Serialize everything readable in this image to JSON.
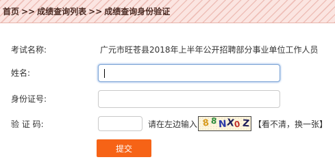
{
  "breadcrumb": {
    "items": [
      "首页",
      "成绩查询列表",
      "成绩查询身份验证"
    ],
    "separator": ">>"
  },
  "exam": {
    "label": "考试名称:",
    "value": "广元市旺苍县2018年上半年公开招聘部分事业单位工作人员"
  },
  "form": {
    "name_label": "姓名:",
    "name_value": "",
    "id_label": "身份证号:",
    "id_value": "",
    "captcha_label": "验 证 码:",
    "captcha_value": "",
    "captcha_hint": "请在左边输入",
    "captcha_text": "88NX0Z",
    "refresh_text": "【看不清，换一张】",
    "submit_label": "提交"
  },
  "colors": {
    "accent": "#f66316",
    "breadcrumb_bg": "#fbe5e1",
    "focus_border": "#7fa5d6"
  }
}
